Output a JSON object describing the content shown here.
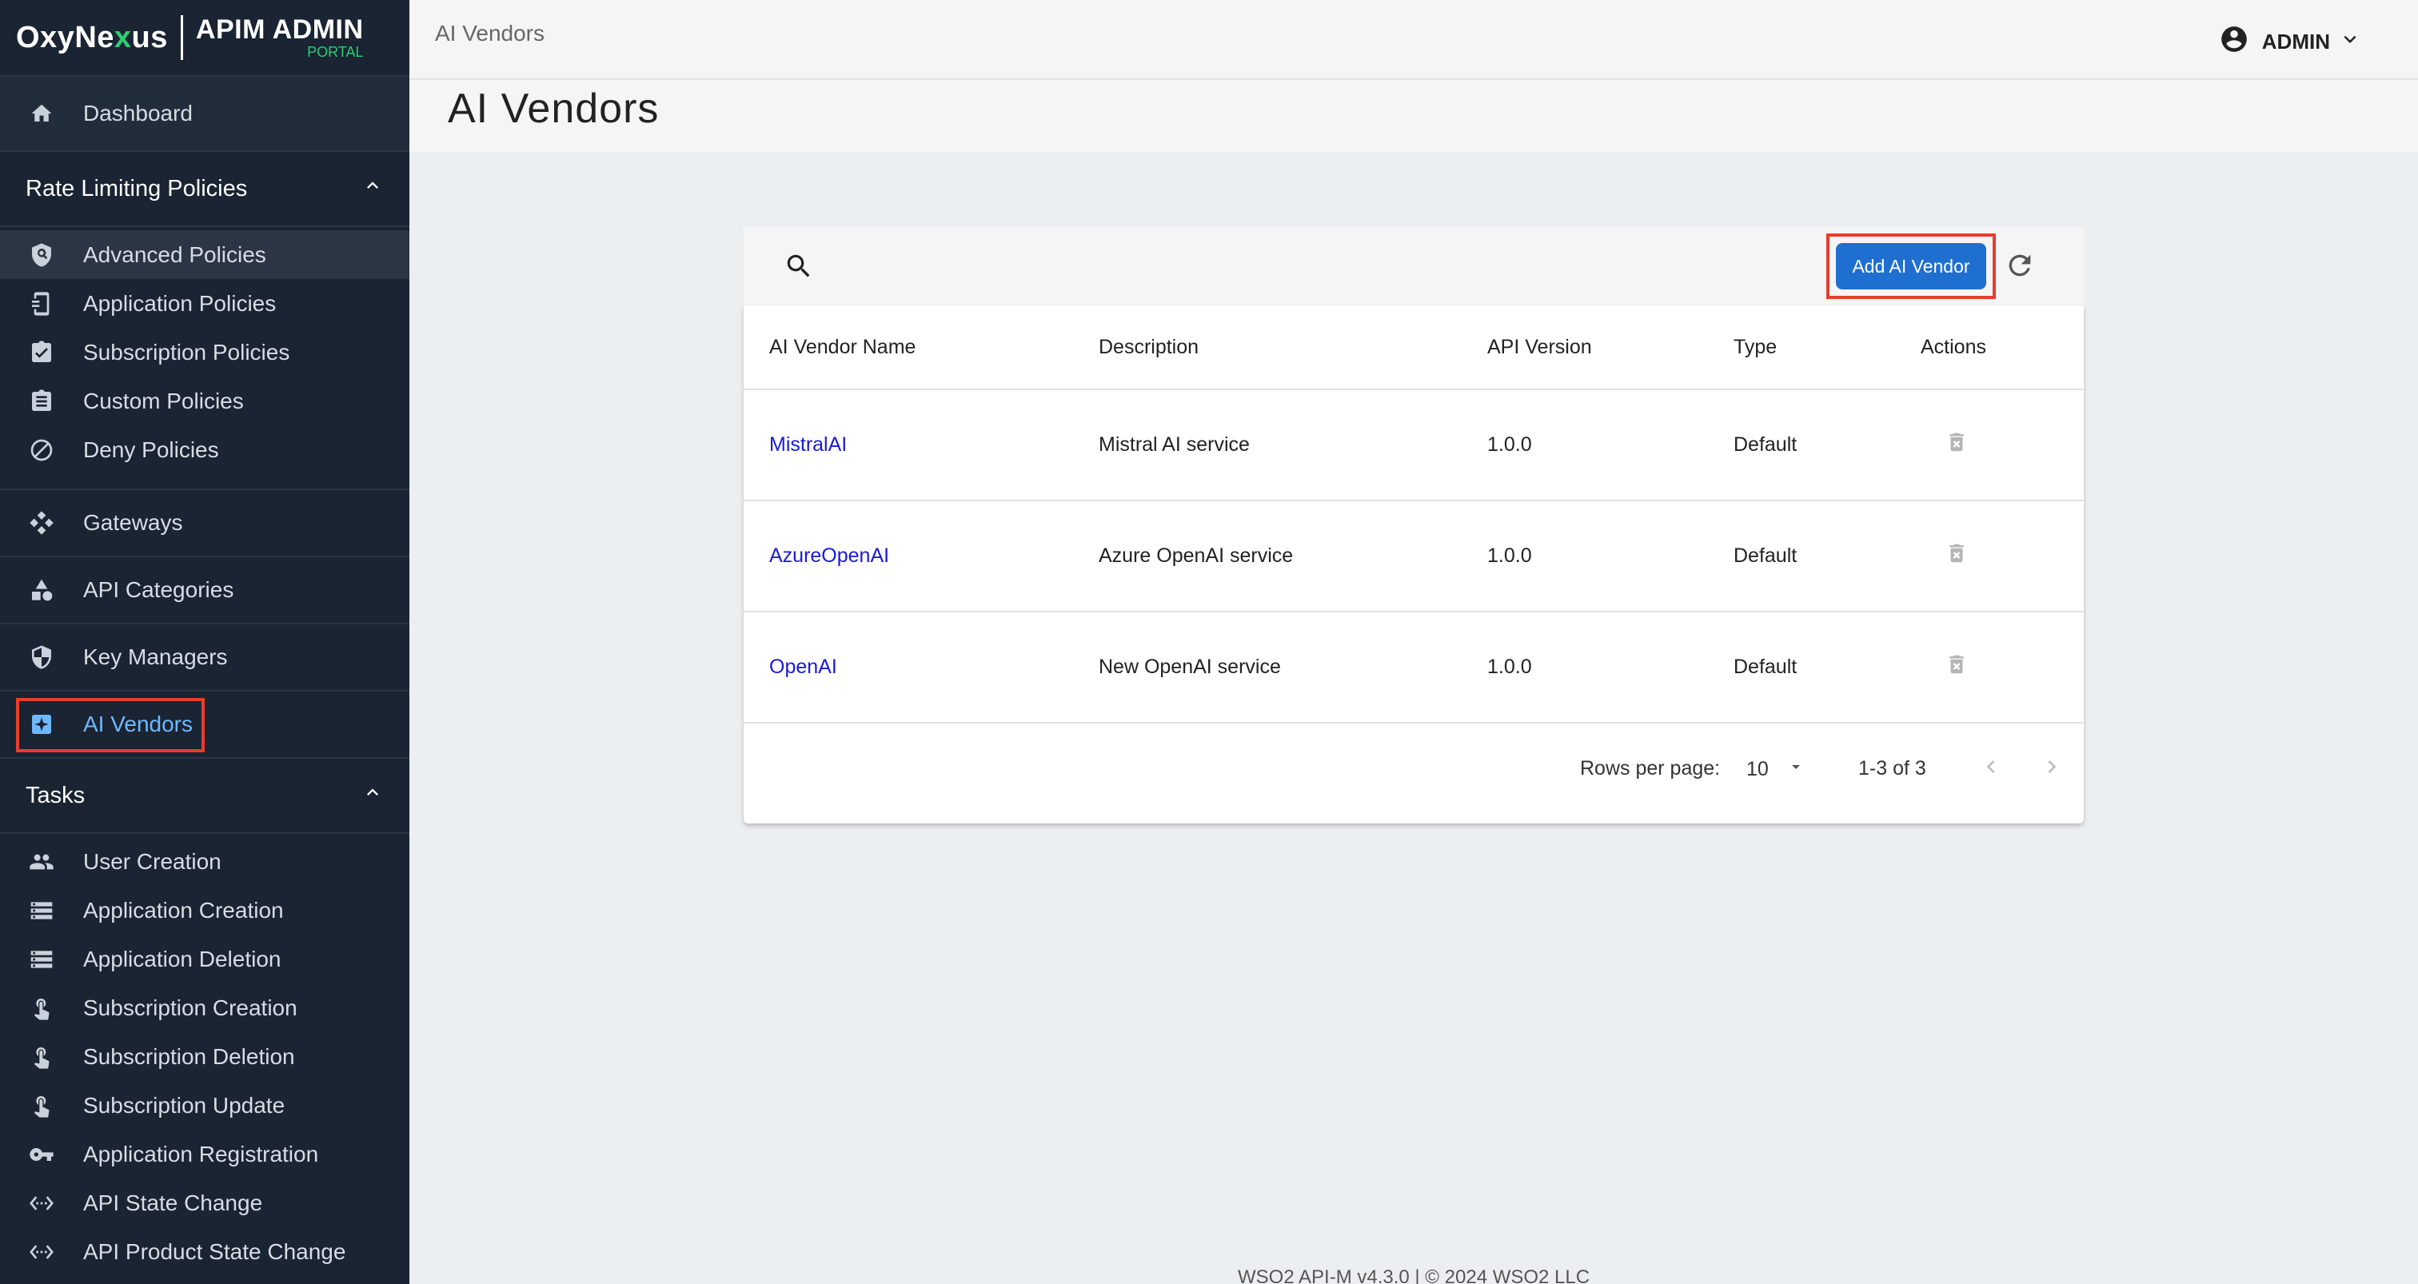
{
  "brand": {
    "logo_pre": "OxyNe",
    "logo_x": "x",
    "logo_post": "us",
    "title": "APIM ADMIN",
    "subtitle": "PORTAL"
  },
  "sidebar": {
    "dashboard": "Dashboard",
    "rate_limiting": {
      "label": "Rate Limiting Policies",
      "items": [
        "Advanced Policies",
        "Application Policies",
        "Subscription Policies",
        "Custom Policies",
        "Deny Policies"
      ]
    },
    "gateways": "Gateways",
    "api_categories": "API Categories",
    "key_managers": "Key Managers",
    "ai_vendors": "AI Vendors",
    "tasks": {
      "label": "Tasks",
      "items": [
        "User Creation",
        "Application Creation",
        "Application Deletion",
        "Subscription Creation",
        "Subscription Deletion",
        "Subscription Update",
        "Application Registration",
        "API State Change",
        "API Product State Change"
      ]
    }
  },
  "topbar": {
    "breadcrumb": "AI Vendors",
    "user": "ADMIN"
  },
  "page": {
    "title": "AI Vendors"
  },
  "toolbar": {
    "add_label": "Add AI Vendor"
  },
  "table": {
    "headers": [
      "AI Vendor Name",
      "Description",
      "API Version",
      "Type",
      "Actions"
    ],
    "rows": [
      {
        "name": "MistralAI",
        "description": "Mistral AI service",
        "version": "1.0.0",
        "type": "Default"
      },
      {
        "name": "AzureOpenAI",
        "description": "Azure OpenAI service",
        "version": "1.0.0",
        "type": "Default"
      },
      {
        "name": "OpenAI",
        "description": "New OpenAI service",
        "version": "1.0.0",
        "type": "Default"
      }
    ],
    "pagination": {
      "rows_label": "Rows per page:",
      "rows_value": "10",
      "range": "1-3 of 3"
    }
  },
  "footer": "WSO2 API-M v4.3.0 | © 2024 WSO2 LLC",
  "colors": {
    "sidebar_bg": "#1a2433",
    "accent": "#1f6fd1",
    "link": "#1a1ad6",
    "highlight": "#e53e2b",
    "brand_green": "#2ecc71"
  }
}
